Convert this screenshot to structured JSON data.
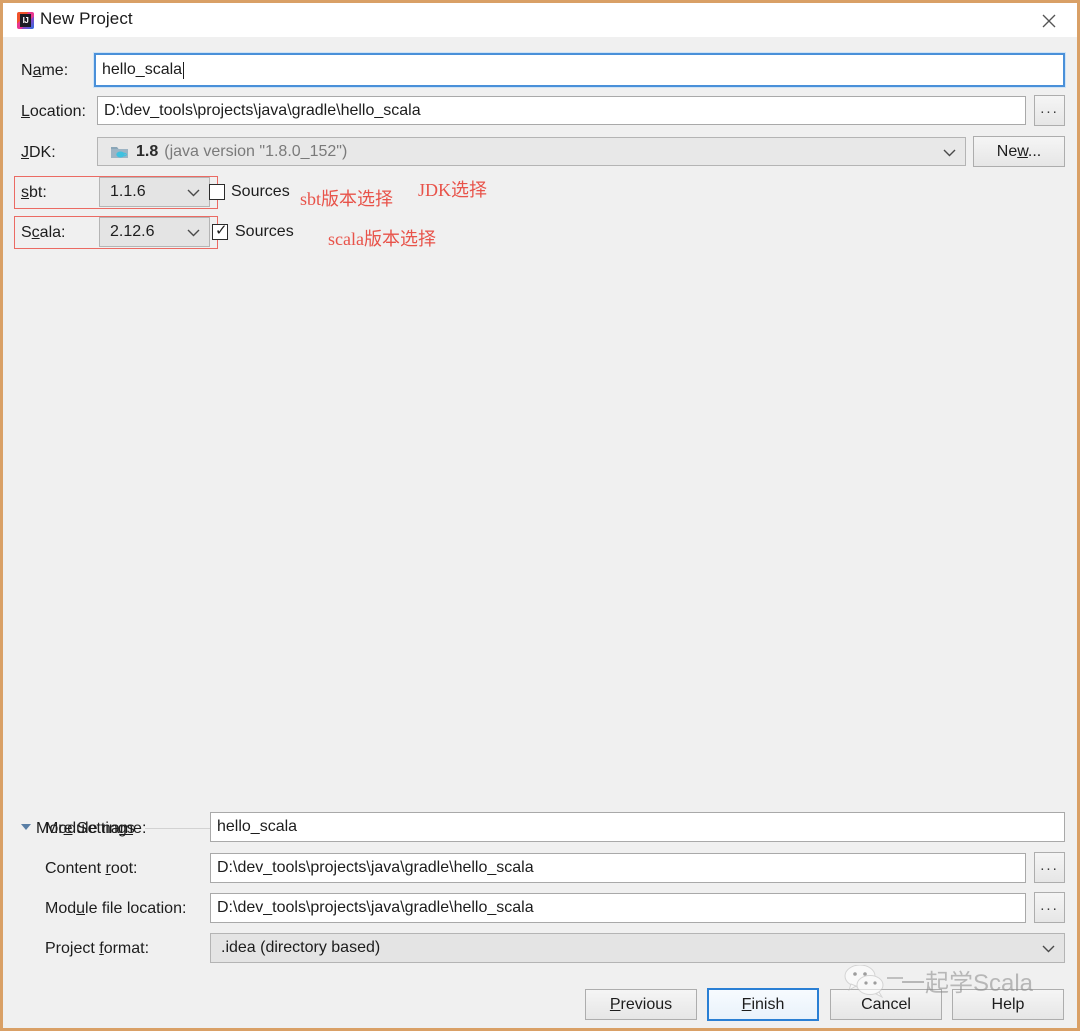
{
  "window": {
    "title": "New Project",
    "app_icon": "intellij-idea-icon",
    "icon_text": "IJ",
    "close_icon": "close-icon",
    "border_color": "#d9a066"
  },
  "form": {
    "name": {
      "label_pre": "N",
      "label_mnemonic": "a",
      "label_post": "me:",
      "value": "hello_scala",
      "focused": true
    },
    "location": {
      "label_pre": "",
      "label_mnemonic": "L",
      "label_post": "ocation:",
      "value": "D:\\dev_tools\\projects\\java\\gradle\\hello_scala",
      "browse_label": "..."
    },
    "jdk": {
      "label_pre": "",
      "label_mnemonic": "J",
      "label_post": "DK:",
      "value_bold": "1.8",
      "value_rest": "(java version \"1.8.0_152\")",
      "icon": "jdk-folder-java-icon",
      "new_button": {
        "pre": "Ne",
        "mnemonic": "w",
        "post": "..."
      }
    },
    "sbt": {
      "label_pre": "",
      "label_mnemonic": "s",
      "label_post": "bt:",
      "value": "1.1.6",
      "sources_label": "Sources",
      "sources_checked": false
    },
    "scala": {
      "label_pre": "S",
      "label_mnemonic": "c",
      "label_post": "ala:",
      "value": "2.12.6",
      "sources_label": "Sources",
      "sources_checked": true,
      "check_glyph": "✓"
    }
  },
  "annotations": {
    "color": "#e8534a",
    "jdk": "JDK选择",
    "sbt": "sbt版本选择",
    "scala": "scala版本选择"
  },
  "more_settings": {
    "label_pre": "Mor",
    "label_mnemonic": "e",
    "label_post": " Settings",
    "expanded": true,
    "module_name": {
      "label_pre": "Module na",
      "label_mnemonic": "m",
      "label_post": "e:",
      "value": "hello_scala"
    },
    "content_root": {
      "label_pre": "Content ",
      "label_mnemonic": "r",
      "label_post": "oot:",
      "value": "D:\\dev_tools\\projects\\java\\gradle\\hello_scala",
      "browse_label": "..."
    },
    "module_file_location": {
      "label_pre": "Mod",
      "label_mnemonic": "u",
      "label_post": "le file location:",
      "value": "D:\\dev_tools\\projects\\java\\gradle\\hello_scala",
      "browse_label": "..."
    },
    "project_format": {
      "label_pre": "Project ",
      "label_mnemonic": "f",
      "label_post": "ormat:",
      "value": ".idea (directory based)"
    }
  },
  "buttons": {
    "previous": {
      "pre": "",
      "mnemonic": "P",
      "post": "revious"
    },
    "finish": {
      "pre": "",
      "mnemonic": "F",
      "post": "inish",
      "focused": true
    },
    "cancel": {
      "pre": "Cancel",
      "mnemonic": "",
      "post": ""
    },
    "help": {
      "pre": "Help",
      "mnemonic": "",
      "post": ""
    }
  },
  "watermark": {
    "text": "一起学Scala",
    "icon": "wechat-icon"
  }
}
